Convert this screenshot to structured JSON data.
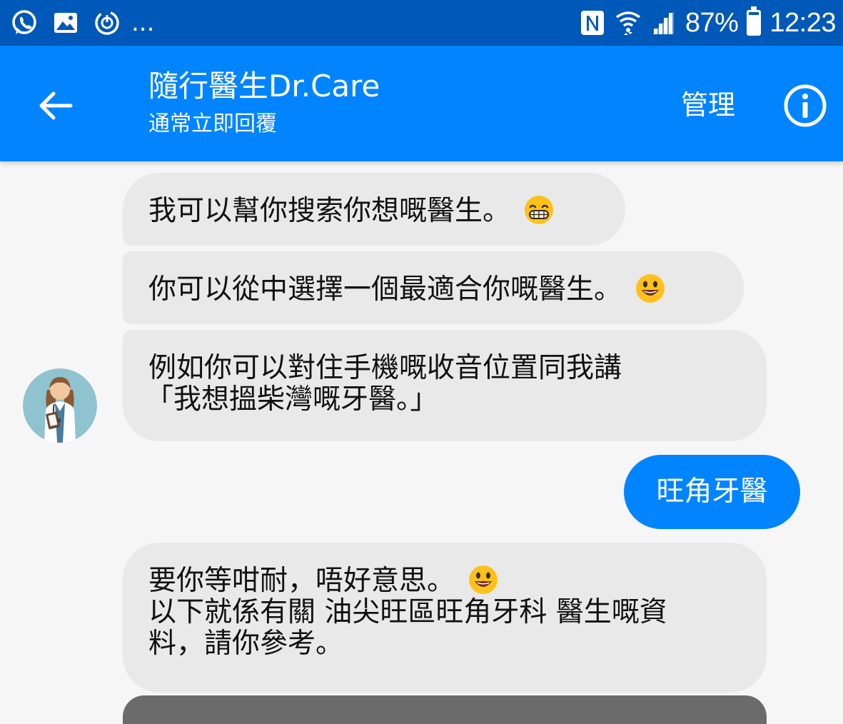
{
  "status_bar": {
    "left_icons": [
      "whatsapp-icon",
      "gallery-icon",
      "power-sync-icon"
    ],
    "overflow": "...",
    "right_icons": [
      "nfc-icon",
      "wifi-icon",
      "signal-icon"
    ],
    "battery_percent": "87%",
    "battery_level": 0.87,
    "time": "12:23"
  },
  "header": {
    "back_icon": "arrow-left-icon",
    "title": "隨行醫生Dr.Care",
    "subtitle": "通常立即回覆",
    "manage_label": "管理",
    "info_icon": "info-circle-icon"
  },
  "messages": {
    "m1": {
      "text": "我可以幫你搜索你想嘅醫生。",
      "emoji": "grinning-teeth-emoji"
    },
    "m2": {
      "text": "你可以從中選擇一個最適合你嘅醫生。",
      "emoji": "smiley-emoji"
    },
    "m3": {
      "line1": "例如你可以對住手機嘅收音位置同我講",
      "line2": "「我想搵柴灣嘅牙醫。」"
    },
    "m4": {
      "text": "旺角牙醫"
    },
    "m5": {
      "line1": "要你等咁耐，唔好意思。",
      "line2": "以下就係有關 油尖旺區旺角牙科 醫生嘅資",
      "line3": "料，請你參考。",
      "emoji": "smiley-emoji"
    }
  },
  "colors": {
    "status_bar": "#0058b8",
    "app_bar": "#0084ff",
    "incoming_bubble": "#e9e9e9",
    "outgoing_bubble": "#0084ff",
    "background": "#f6f6f6"
  }
}
